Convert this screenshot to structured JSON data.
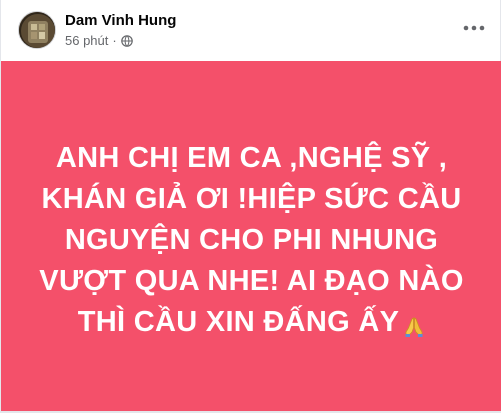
{
  "post": {
    "author": "Dam Vinh Hung",
    "time": "56 phút",
    "separator": "·",
    "privacy_icon": "globe-icon",
    "more_icon": "more-horizontal-icon",
    "background_color": "#f4506a",
    "text_lines": [
      "ANH CHỊ EM CA ,NGHỆ SỸ ,",
      "KHÁN GIẢ ƠI !HIỆP SỨC CẦU",
      "NGUYỆN CHO PHI NHUNG",
      "VƯỢT QUA NHE! AI ĐẠO NÀO",
      "THÌ CẦU XIN ĐẤNG ẤY"
    ],
    "emoji": "folded-hands-icon"
  }
}
